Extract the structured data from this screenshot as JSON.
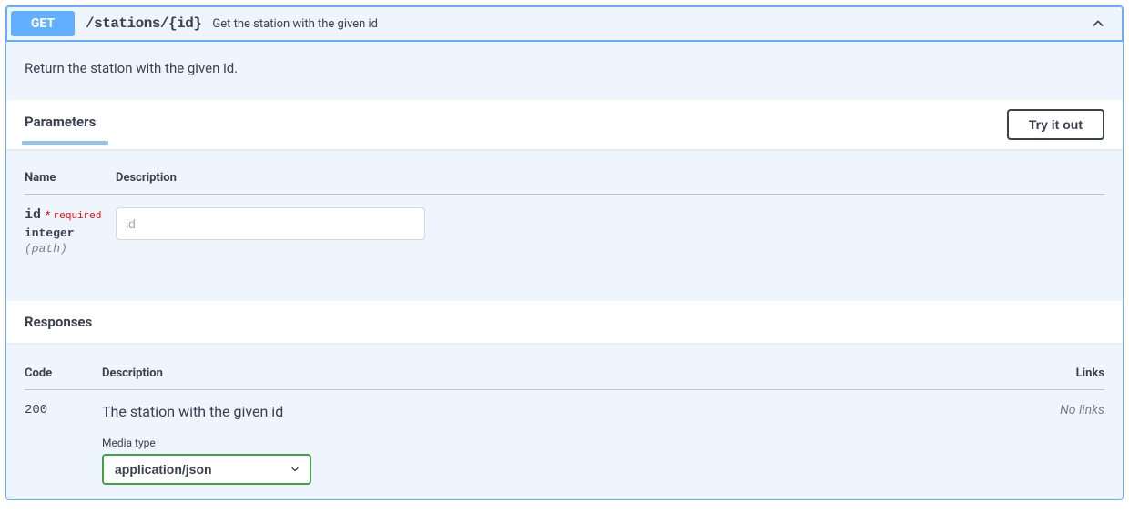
{
  "operation": {
    "method": "GET",
    "path": "/stations/{id}",
    "summary": "Get the station with the given id",
    "description": "Return the station with the given id."
  },
  "parametersSection": {
    "title": "Parameters",
    "tryItOutLabel": "Try it out",
    "columns": {
      "name": "Name",
      "description": "Description"
    },
    "items": [
      {
        "name": "id",
        "requiredLabel": "required",
        "type": "integer",
        "in": "(path)",
        "placeholder": "id",
        "value": ""
      }
    ]
  },
  "responsesSection": {
    "title": "Responses",
    "columns": {
      "code": "Code",
      "description": "Description",
      "links": "Links"
    },
    "items": [
      {
        "code": "200",
        "description": "The station with the given id",
        "links": "No links",
        "mediaTypeLabel": "Media type",
        "mediaTypeSelected": "application/json",
        "mediaTypeOptions": [
          "application/json"
        ]
      }
    ]
  }
}
